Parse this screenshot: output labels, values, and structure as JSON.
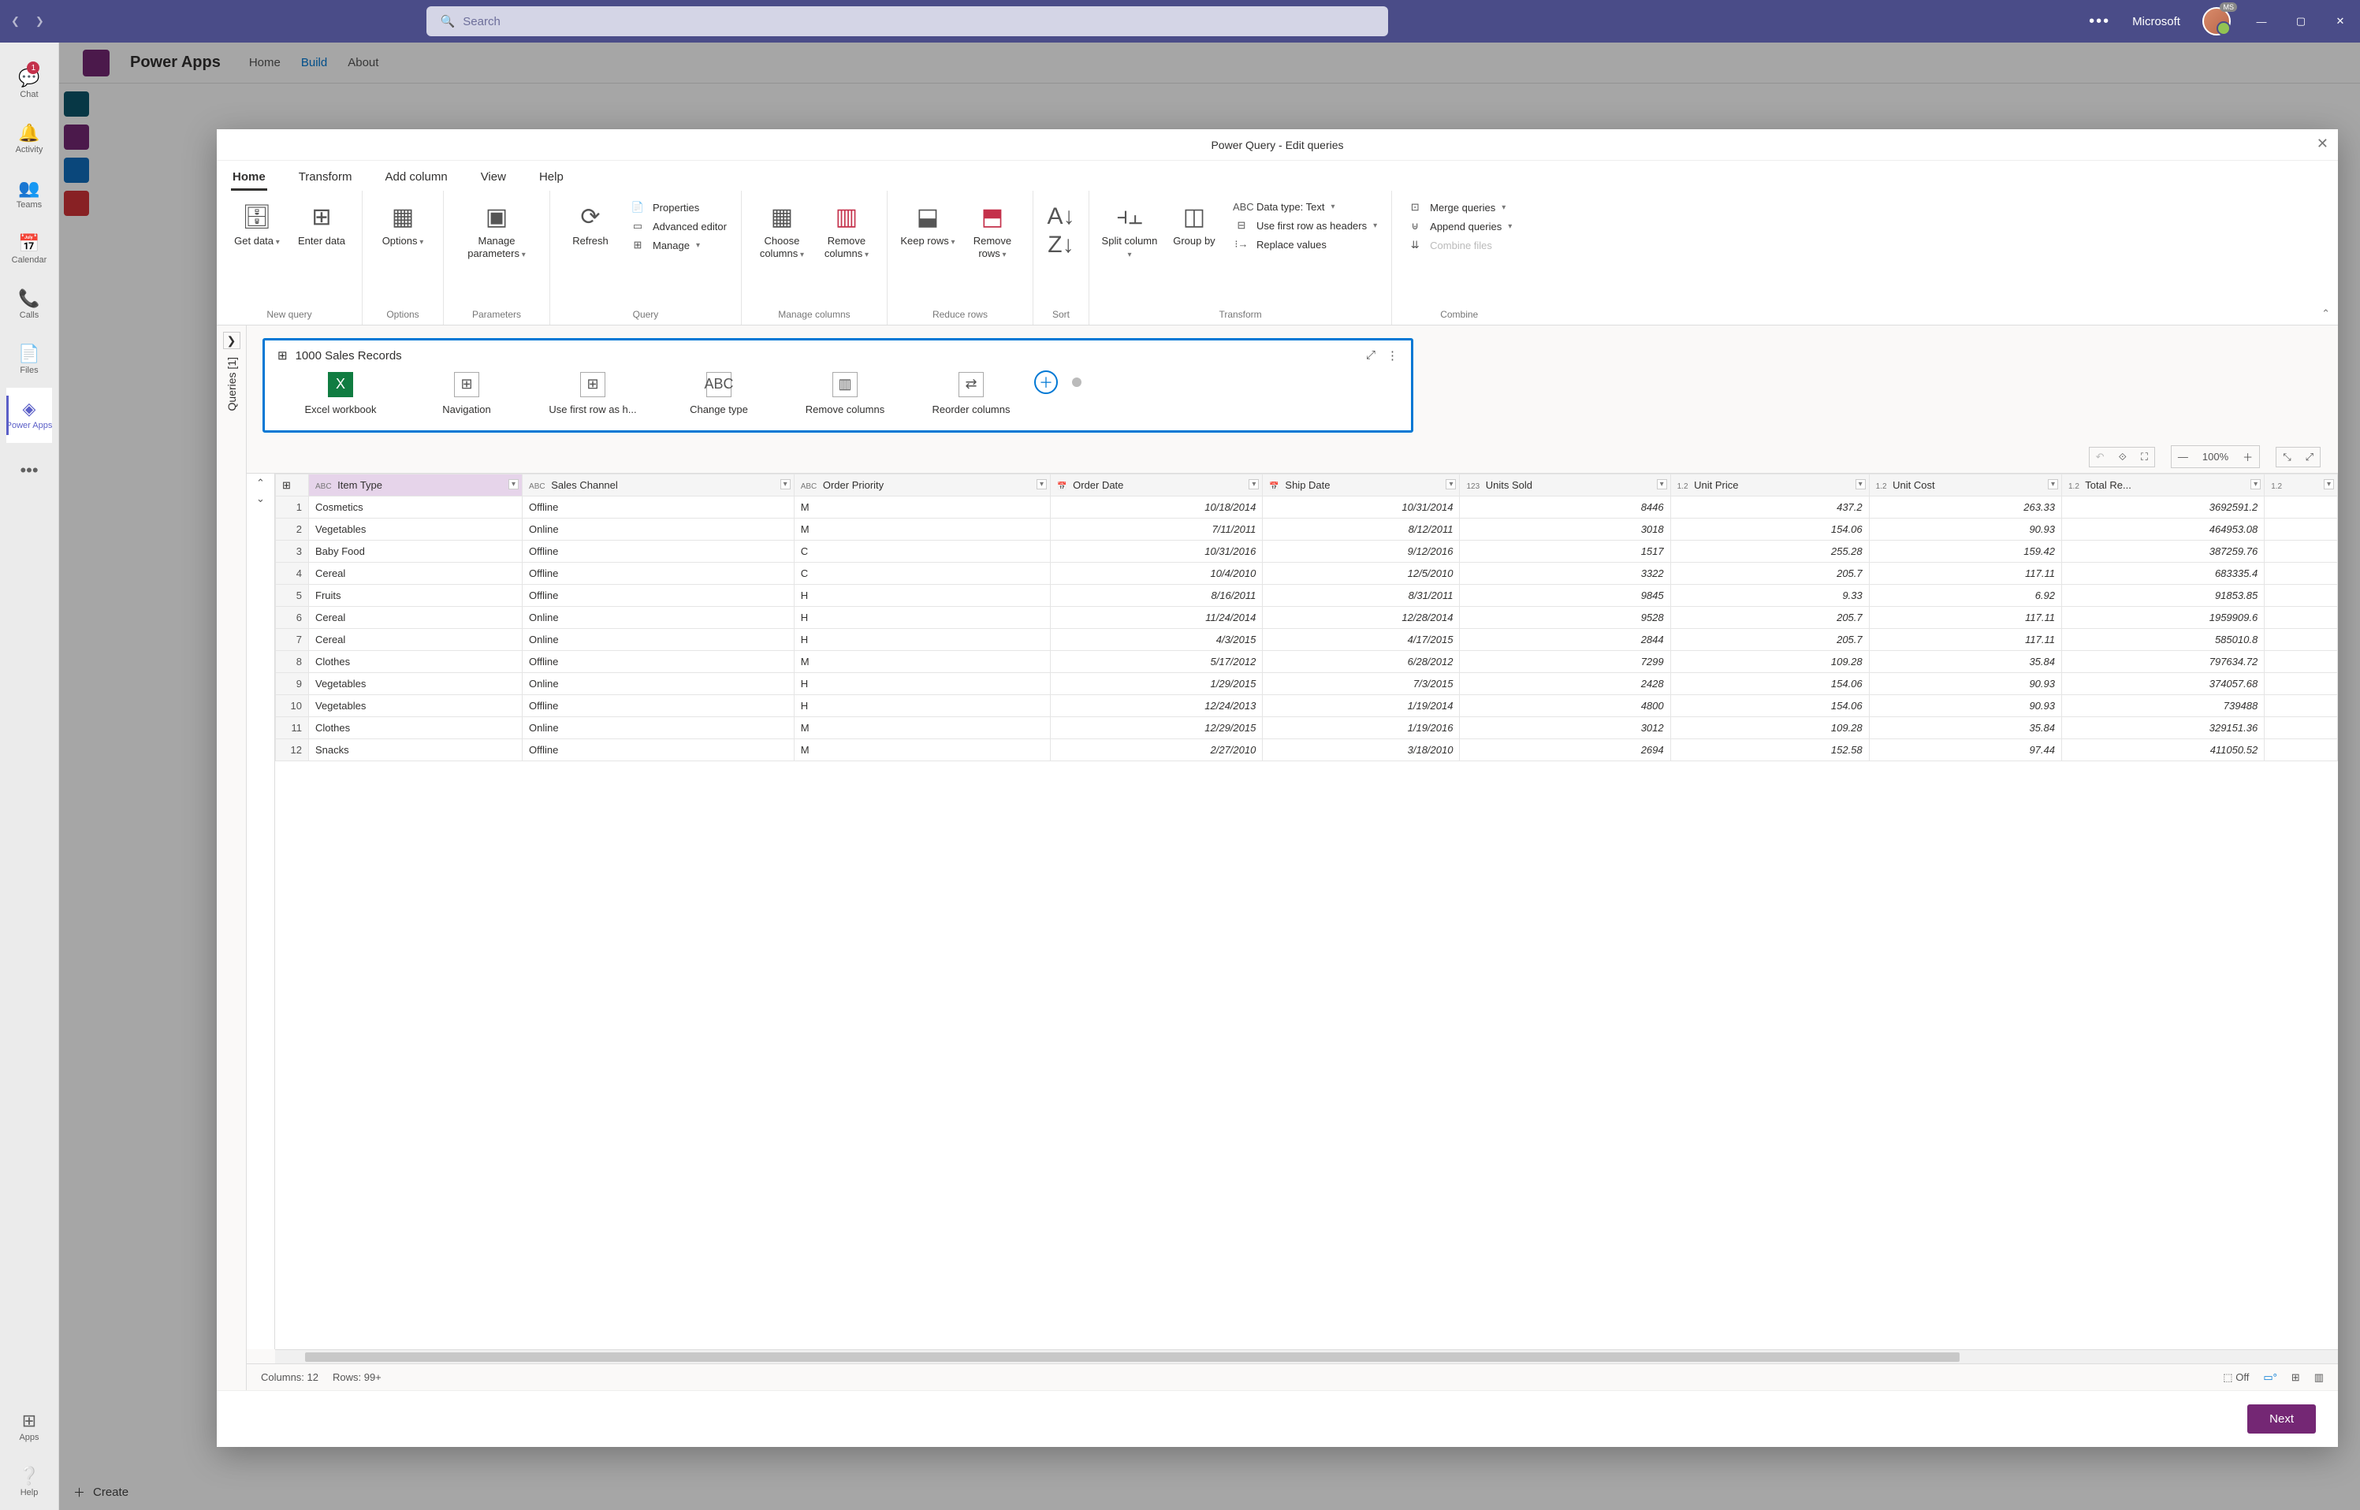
{
  "titlebar": {
    "search_placeholder": "Search",
    "org": "Microsoft",
    "avatar_badge": "MS"
  },
  "leftnav": {
    "items": [
      {
        "icon": "💬",
        "label": "Chat",
        "badge": "1"
      },
      {
        "icon": "🔔",
        "label": "Activity"
      },
      {
        "icon": "👥",
        "label": "Teams"
      },
      {
        "icon": "📅",
        "label": "Calendar"
      },
      {
        "icon": "📞",
        "label": "Calls"
      },
      {
        "icon": "📄",
        "label": "Files"
      },
      {
        "icon": "◈",
        "label": "Power Apps",
        "active": true
      }
    ],
    "bottom": [
      {
        "icon": "⊞",
        "label": "Apps"
      },
      {
        "icon": "❔",
        "label": "Help"
      }
    ]
  },
  "powerapps": {
    "title": "Power Apps",
    "tabs": [
      "Home",
      "Build",
      "About"
    ],
    "active": "Build",
    "create_label": "Create"
  },
  "dialog": {
    "title": "Power Query - Edit queries",
    "tabs": [
      "Home",
      "Transform",
      "Add column",
      "View",
      "Help"
    ],
    "active_tab": "Home",
    "groups": {
      "newquery": {
        "label": "New query",
        "get_data": "Get data",
        "enter_data": "Enter data"
      },
      "options": {
        "label": "Options",
        "options": "Options"
      },
      "parameters": {
        "label": "Parameters",
        "manage": "Manage parameters"
      },
      "query": {
        "label": "Query",
        "refresh": "Refresh",
        "properties": "Properties",
        "adv": "Advanced editor",
        "manage": "Manage"
      },
      "managecols": {
        "label": "Manage columns",
        "choose": "Choose columns",
        "remove": "Remove columns"
      },
      "reduce": {
        "label": "Reduce rows",
        "keep": "Keep rows",
        "remove": "Remove rows"
      },
      "sort": {
        "label": "Sort"
      },
      "transform": {
        "label": "Transform",
        "split": "Split column",
        "group": "Group by",
        "datatype": "Data type: Text",
        "firstrow": "Use first row as headers",
        "replace": "Replace values"
      },
      "combine": {
        "label": "Combine",
        "merge": "Merge queries",
        "append": "Append queries",
        "files": "Combine files"
      }
    },
    "queries_tab": "Queries [1]",
    "diagram": {
      "title": "1000 Sales Records",
      "steps": [
        "Excel workbook",
        "Navigation",
        "Use first row as h...",
        "Change type",
        "Remove columns",
        "Reorder columns"
      ]
    },
    "zoom": "100%",
    "grid": {
      "columns": [
        {
          "type": "ABC",
          "name": "Item Type",
          "sel": true
        },
        {
          "type": "ABC",
          "name": "Sales Channel"
        },
        {
          "type": "ABC",
          "name": "Order Priority"
        },
        {
          "type": "📅",
          "name": "Order Date"
        },
        {
          "type": "📅",
          "name": "Ship Date"
        },
        {
          "type": "123",
          "name": "Units Sold"
        },
        {
          "type": "1.2",
          "name": "Unit Price"
        },
        {
          "type": "1.2",
          "name": "Unit Cost"
        },
        {
          "type": "1.2",
          "name": "Total Re..."
        },
        {
          "type": "1.2",
          "name": ""
        }
      ],
      "rows": [
        [
          "Cosmetics",
          "Offline",
          "M",
          "10/18/2014",
          "10/31/2014",
          "8446",
          "437.2",
          "263.33",
          "3692591.2"
        ],
        [
          "Vegetables",
          "Online",
          "M",
          "7/11/2011",
          "8/12/2011",
          "3018",
          "154.06",
          "90.93",
          "464953.08"
        ],
        [
          "Baby Food",
          "Offline",
          "C",
          "10/31/2016",
          "9/12/2016",
          "1517",
          "255.28",
          "159.42",
          "387259.76"
        ],
        [
          "Cereal",
          "Offline",
          "C",
          "10/4/2010",
          "12/5/2010",
          "3322",
          "205.7",
          "117.11",
          "683335.4"
        ],
        [
          "Fruits",
          "Offline",
          "H",
          "8/16/2011",
          "8/31/2011",
          "9845",
          "9.33",
          "6.92",
          "91853.85"
        ],
        [
          "Cereal",
          "Online",
          "H",
          "11/24/2014",
          "12/28/2014",
          "9528",
          "205.7",
          "117.11",
          "1959909.6"
        ],
        [
          "Cereal",
          "Online",
          "H",
          "4/3/2015",
          "4/17/2015",
          "2844",
          "205.7",
          "117.11",
          "585010.8"
        ],
        [
          "Clothes",
          "Offline",
          "M",
          "5/17/2012",
          "6/28/2012",
          "7299",
          "109.28",
          "35.84",
          "797634.72"
        ],
        [
          "Vegetables",
          "Online",
          "H",
          "1/29/2015",
          "7/3/2015",
          "2428",
          "154.06",
          "90.93",
          "374057.68"
        ],
        [
          "Vegetables",
          "Offline",
          "H",
          "12/24/2013",
          "1/19/2014",
          "4800",
          "154.06",
          "90.93",
          "739488"
        ],
        [
          "Clothes",
          "Online",
          "M",
          "12/29/2015",
          "1/19/2016",
          "3012",
          "109.28",
          "35.84",
          "329151.36"
        ],
        [
          "Snacks",
          "Offline",
          "M",
          "2/27/2010",
          "3/18/2010",
          "2694",
          "152.58",
          "97.44",
          "411050.52"
        ]
      ]
    },
    "status": {
      "cols": "Columns: 12",
      "rows": "Rows: 99+",
      "switch": "Off"
    },
    "next": "Next"
  }
}
